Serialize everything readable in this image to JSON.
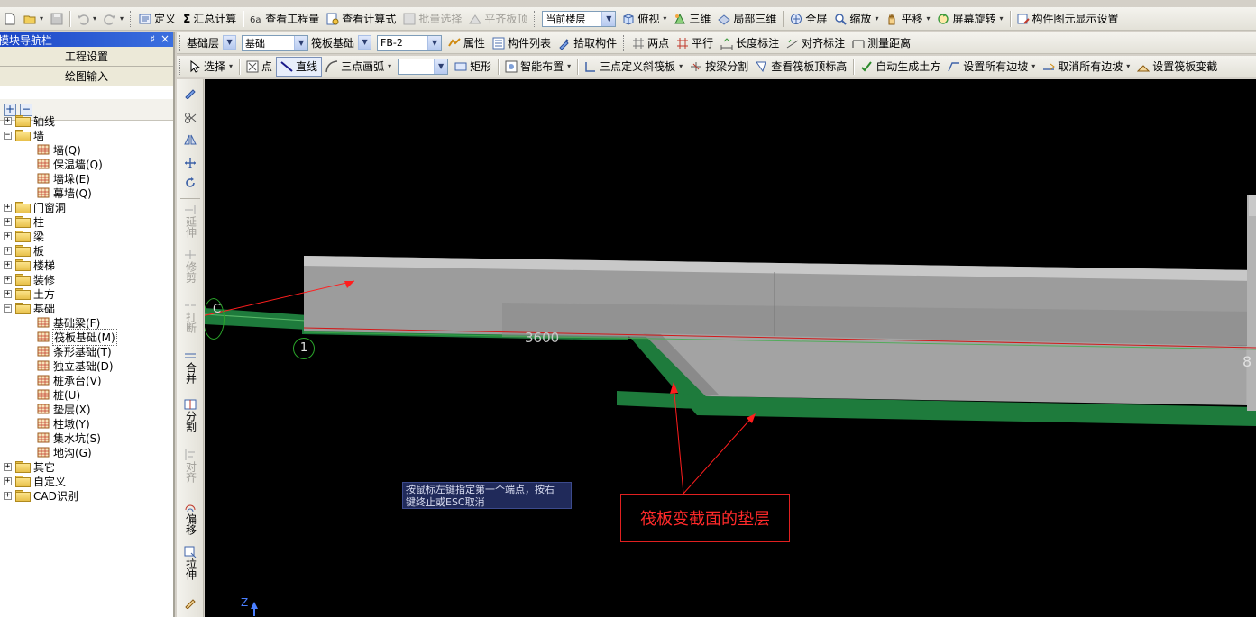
{
  "toolbar_main": {
    "define": "定义",
    "sum_calc": "汇总计算",
    "view_quantity": "查看工程量",
    "view_formula": "查看计算式",
    "batch_select": "批量选择",
    "align_top": "平齐板顶",
    "floor_select": "当前楼层",
    "top_view": "俯视",
    "three_d": "三维",
    "local_3d": "局部三维",
    "fullscreen": "全屏",
    "zoom": "缩放",
    "pan": "平移",
    "rotate": "屏幕旋转",
    "display_settings": "构件图元显示设置"
  },
  "toolbar_component": {
    "floor": "基础层",
    "category": "基础",
    "type": "筏板基础",
    "name": "FB-2",
    "properties": "属性",
    "component_list": "构件列表",
    "pick_component": "拾取构件",
    "two_points": "两点",
    "parallel": "平行",
    "length_dim": "长度标注",
    "align_dim": "对齐标注",
    "measure": "测量距离"
  },
  "toolbar_draw": {
    "select": "选择",
    "point": "点",
    "line": "直线",
    "arc": "三点画弧",
    "rect": "矩形",
    "smart_layout": "智能布置",
    "slope_raft": "三点定义斜筏板",
    "split_by_beam": "按梁分割",
    "view_raft_elev": "查看筏板顶标高",
    "auto_earthwork": "自动生成土方",
    "set_all_slopes": "设置所有边坡",
    "cancel_all_slopes": "取消所有边坡",
    "set_raft_change": "设置筏板变截"
  },
  "nav": {
    "title": "模块导航栏",
    "pin": "♯",
    "close": "×",
    "section_project": "工程设置",
    "section_draw": "绘图输入",
    "tree": [
      {
        "label": "轴线",
        "level": 0,
        "expanded": false
      },
      {
        "label": "墙",
        "level": 0,
        "expanded": true
      },
      {
        "label": "墙(Q)",
        "level": 1
      },
      {
        "label": "保温墙(Q)",
        "level": 1
      },
      {
        "label": "墙垛(E)",
        "level": 1
      },
      {
        "label": "幕墙(Q)",
        "level": 1
      },
      {
        "label": "门窗洞",
        "level": 0,
        "expanded": false
      },
      {
        "label": "柱",
        "level": 0,
        "expanded": false
      },
      {
        "label": "梁",
        "level": 0,
        "expanded": false
      },
      {
        "label": "板",
        "level": 0,
        "expanded": false
      },
      {
        "label": "楼梯",
        "level": 0,
        "expanded": false
      },
      {
        "label": "装修",
        "level": 0,
        "expanded": false
      },
      {
        "label": "土方",
        "level": 0,
        "expanded": false
      },
      {
        "label": "基础",
        "level": 0,
        "expanded": true
      },
      {
        "label": "基础梁(F)",
        "level": 1
      },
      {
        "label": "筏板基础(M)",
        "level": 1,
        "selected": true
      },
      {
        "label": "条形基础(T)",
        "level": 1
      },
      {
        "label": "独立基础(D)",
        "level": 1
      },
      {
        "label": "桩承台(V)",
        "level": 1
      },
      {
        "label": "桩(U)",
        "level": 1
      },
      {
        "label": "垫层(X)",
        "level": 1
      },
      {
        "label": "柱墩(Y)",
        "level": 1
      },
      {
        "label": "集水坑(S)",
        "level": 1
      },
      {
        "label": "地沟(G)",
        "level": 1
      },
      {
        "label": "其它",
        "level": 0,
        "expanded": false
      },
      {
        "label": "自定义",
        "level": 0,
        "expanded": false
      },
      {
        "label": "CAD识别",
        "level": 0,
        "expanded": false
      }
    ]
  },
  "vtoolbar": {
    "extend": "延伸",
    "trim": "修剪",
    "break": "打断",
    "merge": "合并",
    "split": "分割",
    "align": "对齐",
    "offset": "偏移",
    "stretch": "拉伸"
  },
  "canvas": {
    "tip_line1": "按鼠标左键指定第一个端点，按右",
    "tip_line2": "键终止或ESC取消",
    "callout": "筏板变截面的垫层",
    "dimension": "3600",
    "axis_1": "1",
    "axis_c": "C",
    "axis_8": "8",
    "z_axis": "Z"
  },
  "colors": {
    "canvas_bg": "#000000",
    "slab_top": "#c4c4c4",
    "slab_face": "#9a9a9a",
    "cushion_green": "#1f7a3a",
    "annotation_red": "#ff2020",
    "title_blue": "#2a5bd7"
  }
}
